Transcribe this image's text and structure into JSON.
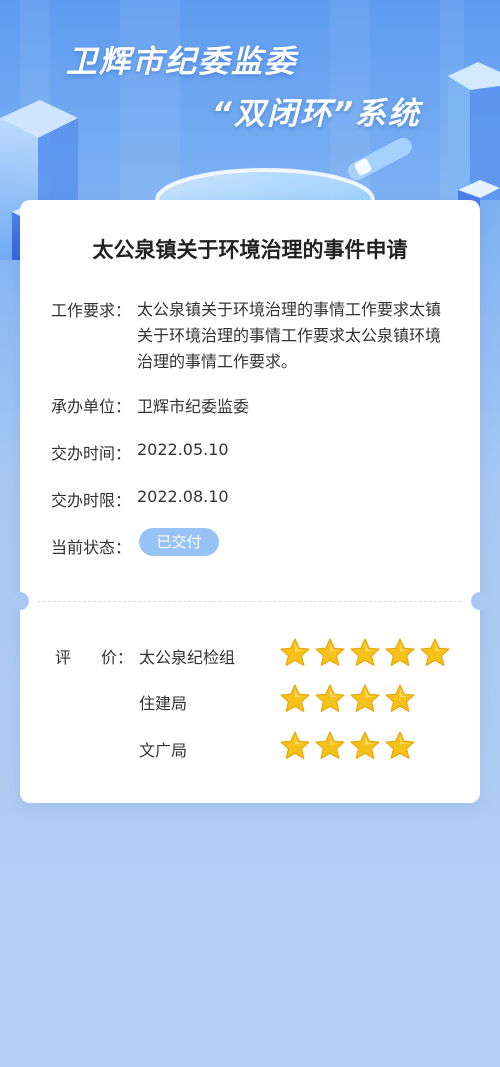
{
  "header": {
    "title_line1": "卫辉市纪委监委",
    "title_line2": "“双闭环”系统"
  },
  "card": {
    "title": "太公泉镇关于环境治理的事件申请",
    "requirement_label": "工作要求：",
    "requirement_text": "太公泉镇关于环境治理的事情工作要求太镇关于环境治理的事情工作要求太公泉镇环境治理的事情工作要求。",
    "unit_label": "承办单位：",
    "unit_value": "卫辉市纪委监委",
    "assign_time_label": "交办时间：",
    "assign_time_value": "2022.05.10",
    "deadline_label": "交办时限：",
    "deadline_value": "2022.08.10",
    "status_label": "当前状态：",
    "status_value": "已交付"
  },
  "evaluation": {
    "label_part1": "评",
    "label_part2": "价：",
    "items": [
      {
        "org": "太公泉纪检组",
        "rating": 5
      },
      {
        "org": "住建局",
        "rating": 4
      },
      {
        "org": "文广局",
        "rating": 4
      }
    ]
  },
  "colors": {
    "accent": "#97c3f6",
    "star": "#f6c21a",
    "background_top": "#5e9bf0",
    "background_bottom": "#b6d0f3"
  },
  "icons": {
    "rating": "star-icon"
  }
}
